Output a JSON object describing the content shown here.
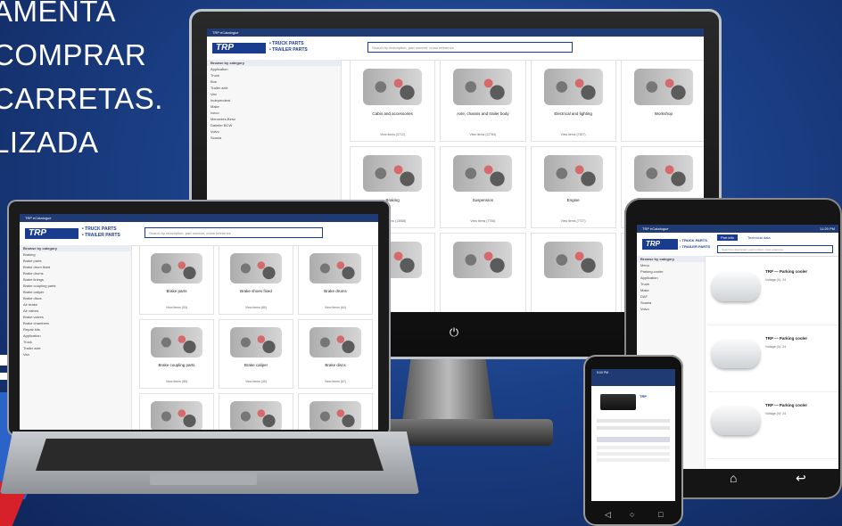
{
  "headline": {
    "lines": [
      "AMENTA",
      "COMPRAR",
      "CARRETAS.",
      "LIZADA"
    ]
  },
  "site": {
    "topbar_text": "TRP eCatalogue",
    "logo_text": "TRP",
    "brand_line1": "• TRUCK PARTS",
    "brand_line2": "• TRAILER PARTS",
    "search_placeholder": "Search by description, part number, cross reference",
    "browse_label": "Browse by category"
  },
  "monitor": {
    "sidebar": [
      "Browse by category",
      "Application",
      "Truck",
      "Bus",
      "Trailer axle",
      "Van",
      "Independent",
      "Make",
      "Iveco",
      "Mercedes-Benz",
      "Daimler BCW",
      "Volvo",
      "Scania"
    ],
    "cards": [
      {
        "label": "Cabin and accessories",
        "sub": "View items (3712)"
      },
      {
        "label": "Axle, chassis and trailer body",
        "sub": "View items (12764)"
      },
      {
        "label": "Electrical and lighting",
        "sub": "View items (7827)"
      },
      {
        "label": "Workshop",
        "sub": ""
      },
      {
        "label": "Braking",
        "sub": "View items (13588)"
      },
      {
        "label": "Suspension",
        "sub": "View items (7736)"
      },
      {
        "label": "Engine",
        "sub": "View items (7727)"
      },
      {
        "label": "",
        "sub": ""
      },
      {
        "label": "",
        "sub": ""
      },
      {
        "label": "",
        "sub": ""
      },
      {
        "label": "",
        "sub": ""
      },
      {
        "label": "",
        "sub": ""
      }
    ],
    "power_icon": "power-icon"
  },
  "laptop": {
    "sidebar": [
      "Browse by category",
      "Braking",
      "Brake parts",
      "Brake drum fixed",
      "Brake drums",
      "Brake linings",
      "Brake coupling parts",
      "Brake caliper",
      "Brake discs",
      "Air brake",
      "Air valves",
      "Brake valves",
      "Brake chambers",
      "Repair kits",
      "Application",
      "Truck",
      "Trailer axle",
      "Van"
    ],
    "cards": [
      {
        "label": "Brake parts",
        "sub": "View items (53)"
      },
      {
        "label": "Brake shoes fixed",
        "sub": "View items (89)"
      },
      {
        "label": "Brake drums",
        "sub": "View items (64)"
      },
      {
        "label": "Brake coupling parts",
        "sub": "View items (58)"
      },
      {
        "label": "Brake caliper",
        "sub": "View items (40)"
      },
      {
        "label": "Brake discs",
        "sub": "View items (67)"
      },
      {
        "label": "",
        "sub": ""
      },
      {
        "label": "",
        "sub": ""
      },
      {
        "label": "",
        "sub": ""
      }
    ]
  },
  "tablet": {
    "status": "11:20 PM",
    "tabs": [
      "Part info",
      "Technical data"
    ],
    "sidebar": [
      "Browse by category",
      "Menu",
      "Parking cooler",
      "Application",
      "Truck",
      "Make",
      "DAF",
      "Scania",
      "Volvo"
    ],
    "products": [
      {
        "title": "TRP — Parking cooler",
        "spec": "Voltage (V): 24"
      },
      {
        "title": "TRP — Parking cooler",
        "spec": "Voltage (V): 24"
      },
      {
        "title": "TRP — Parking cooler",
        "spec": "Voltage (V): 24"
      }
    ],
    "nav": {
      "home_icon": "home-icon",
      "back_icon": "back-icon"
    }
  },
  "phone": {
    "status": "5:00 PM",
    "product_code": "TRP",
    "nav": {
      "back_icon": "back-icon",
      "home_icon": "home-icon",
      "recent_icon": "recent-icon"
    }
  },
  "colors": {
    "background": "#1b3f86",
    "brand_blue": "#1a3c8f",
    "accent_red": "#d6202a"
  }
}
